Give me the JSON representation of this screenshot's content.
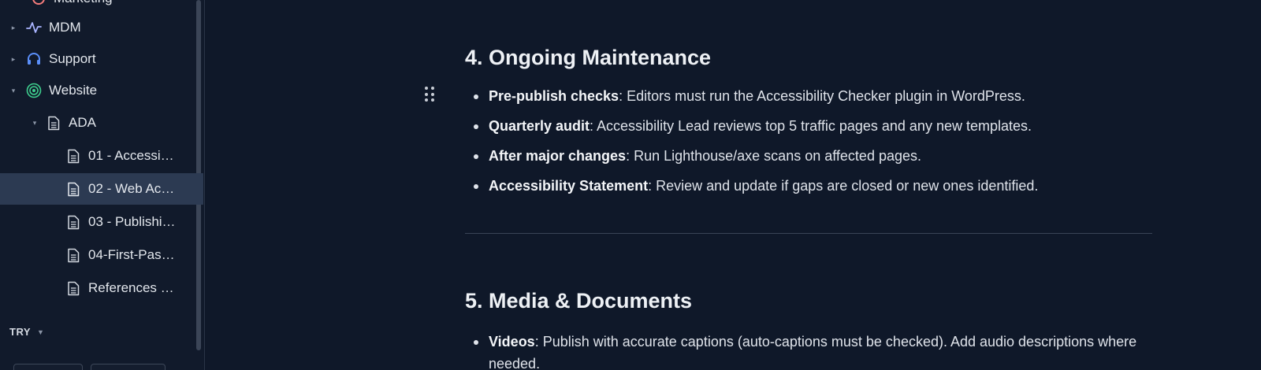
{
  "sidebar": {
    "items": [
      {
        "label": "Marketing",
        "arrow": "",
        "icon": "marketing-icon"
      },
      {
        "label": "MDM",
        "arrow": "▸",
        "icon": "activity-icon"
      },
      {
        "label": "Support",
        "arrow": "▸",
        "icon": "headphones-icon"
      },
      {
        "label": "Website",
        "arrow": "▾",
        "icon": "target-icon"
      },
      {
        "label": "ADA",
        "arrow": "▾",
        "icon": "document-icon"
      },
      {
        "label": "01 - Accessi…",
        "icon": "document-icon"
      },
      {
        "label": "02 - Web Ac…",
        "icon": "document-icon",
        "selected": true
      },
      {
        "label": "03 - Publishi…",
        "icon": "document-icon"
      },
      {
        "label": "04-First-Pas…",
        "icon": "document-icon"
      },
      {
        "label": "References …",
        "icon": "document-icon"
      }
    ],
    "try_label": "TRY"
  },
  "main": {
    "sections": [
      {
        "heading": "4. Ongoing Maintenance",
        "bullets": [
          {
            "bold": "Pre-publish checks",
            "text": ": Editors must run the Accessibility Checker plugin in WordPress."
          },
          {
            "bold": "Quarterly audit",
            "text": ": Accessibility Lead reviews top 5 traffic pages and any new templates."
          },
          {
            "bold": "After major changes",
            "text": ": Run Lighthouse/axe scans on affected pages."
          },
          {
            "bold": "Accessibility Statement",
            "text": ": Review and update if gaps are closed or new ones identified."
          }
        ]
      },
      {
        "heading": "5. Media & Documents",
        "bullets": [
          {
            "bold": "Videos",
            "text": ": Publish with accurate captions (auto-captions must be checked). Add audio descriptions where needed."
          }
        ]
      }
    ]
  },
  "colors": {
    "background": "#0f1829",
    "sidebar": "#111a2b",
    "selected": "#2c3a52",
    "mdm_icon": "#a9b4ff",
    "support_icon": "#5b8ff9",
    "website_icon": "#3ecf8e",
    "marketing_icon": "#f47c7c"
  }
}
